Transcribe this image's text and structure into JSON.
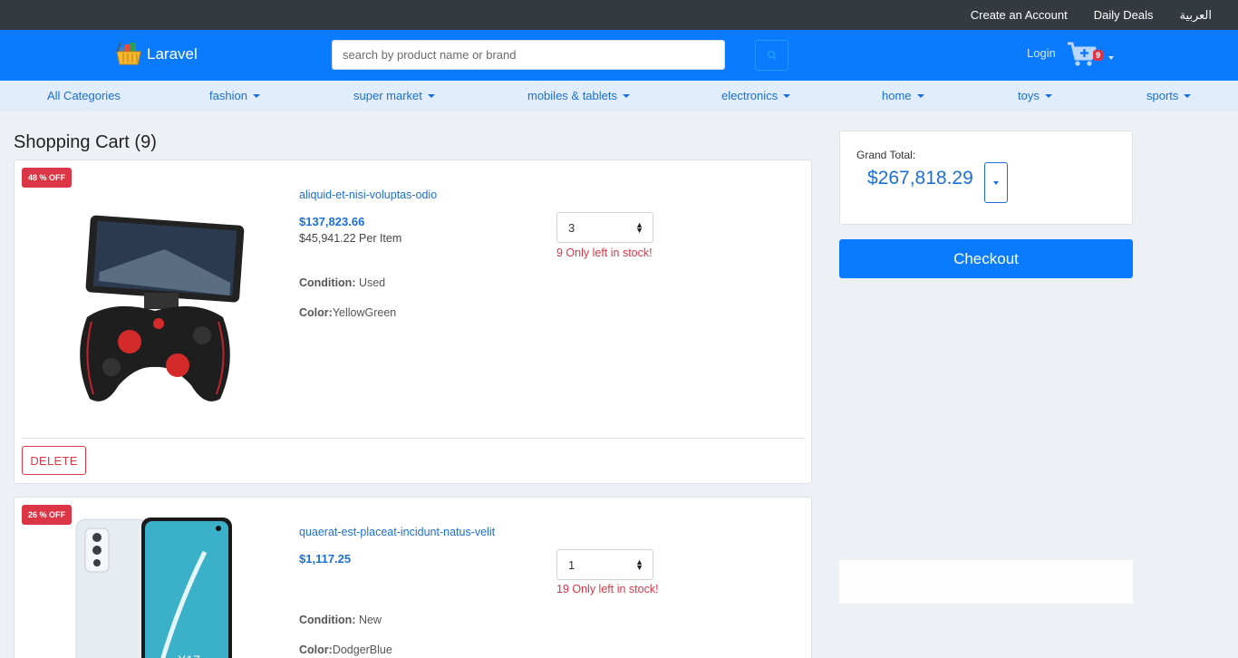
{
  "topbar": {
    "links": [
      "Create an Account",
      "Daily Deals",
      "العربية"
    ]
  },
  "header": {
    "brand": "Laravel",
    "search_placeholder": "search by product name or brand",
    "login": "Login",
    "cart_count": "9"
  },
  "categories": [
    "All Categories",
    "fashion",
    "super market",
    "mobiles & tablets",
    "electronics",
    "home",
    "toys",
    "sports"
  ],
  "cart": {
    "title": "Shopping Cart (9)",
    "items": [
      {
        "discount": "48 % OFF",
        "name": "aliquid-et-nisi-voluptas-odio",
        "price": "$137,823.66",
        "per_item": "$45,941.22 Per Item",
        "condition_label": "Condition:",
        "condition": " Used",
        "color_label": "Color:",
        "color": "YellowGreen",
        "quantity": "3",
        "stock": "9 Only left in stock!",
        "delete_label": "DELETE"
      },
      {
        "discount": "26 % OFF",
        "name": "quaerat-est-placeat-incidunt-natus-velit",
        "price": "$1,117.25",
        "condition_label": "Condition:",
        "condition": " New",
        "color_label": "Color:",
        "color": "DodgerBlue",
        "quantity": "1",
        "stock": "19 Only left in stock!"
      }
    ]
  },
  "summary": {
    "grand_total_label": "Grand Total:",
    "grand_total": "$267,818.29",
    "checkout_label": "Checkout"
  },
  "colors": {
    "primary": "#0a7bff",
    "topbar": "#343a40",
    "danger": "#dc3545",
    "link": "#1a6fd8"
  }
}
